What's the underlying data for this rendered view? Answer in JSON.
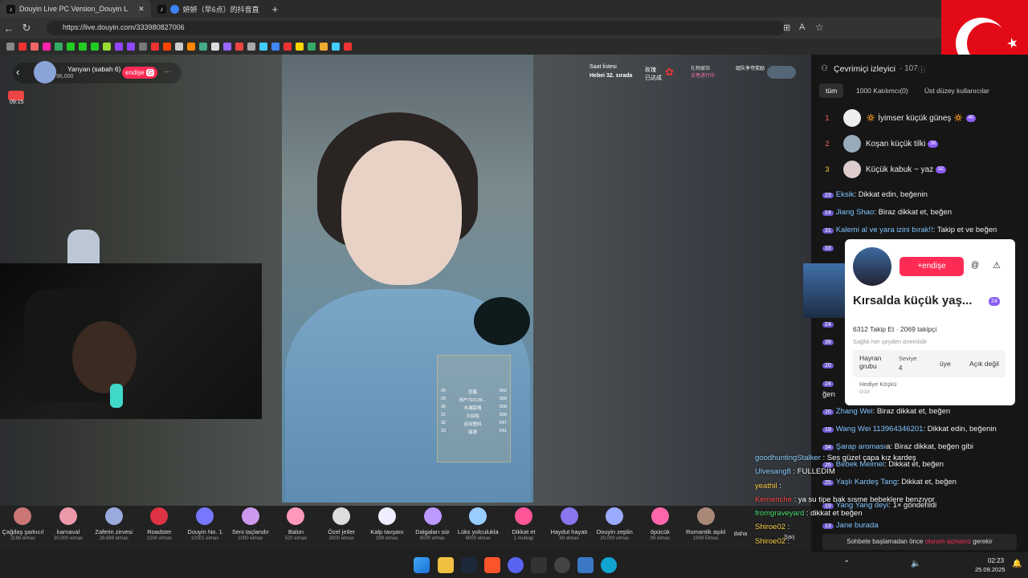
{
  "browser": {
    "tabs": [
      {
        "title": "Douyin Live PC Version_Douyin L",
        "close": "✕"
      },
      {
        "title": "妍妍（早6点）的抖音直"
      },
      {
        "title": "+"
      }
    ],
    "url": "https://live.douyin.com/333980827006"
  },
  "stream": {
    "host_name": "Yanyan (sabah 6)",
    "host_followers": "96,000",
    "follow_label": "endişe",
    "timer": "09:15",
    "hourly_rank_title": "Saat listesi",
    "hourly_rank_value": "Hebei 32. sırada",
    "promo1_line1": "玫瑰",
    "promo1_line2": "已达成",
    "promo2_line1": "礼物展馆",
    "promo2_line2": "点亮进行中",
    "promo3": "组队争夺奖励"
  },
  "ticket": {
    "rows": [
      {
        "num": "26",
        "name": "恋箱",
        "val": "562"
      },
      {
        "num": "29",
        "name": "用户703136...",
        "val": "559"
      },
      {
        "num": "30",
        "name": "木城踪情",
        "val": "558"
      },
      {
        "num": "31",
        "name": "大伯船",
        "val": "556"
      },
      {
        "num": "32",
        "name": "运动塑料",
        "val": "547"
      },
      {
        "num": "33",
        "name": "接骑",
        "val": "541"
      }
    ]
  },
  "gifts": [
    {
      "name": "Çağdaş şarkıcıl",
      "price": "3188 elmas"
    },
    {
      "name": "karnaval",
      "price": "30.000 elmas"
    },
    {
      "name": "Zaferin zirvesi",
      "price": "28.888 elmas"
    },
    {
      "name": "Roadster",
      "price": "1200 elmas"
    },
    {
      "name": "Douyin No. 1",
      "price": "10001 elmas"
    },
    {
      "name": "Seni taçlandır",
      "price": "1000 elmas"
    },
    {
      "name": "Balon",
      "price": "520 elmas"
    },
    {
      "name": "Özel jetler",
      "price": "3000 elmas"
    },
    {
      "name": "Kalp tavşanı",
      "price": "299 elmas"
    },
    {
      "name": "Dalgaları sür",
      "price": "8000 elmas"
    },
    {
      "name": "Lüks yolculukla",
      "price": "6000 elmas"
    },
    {
      "name": "Dikkat et",
      "price": "1 mutkap"
    },
    {
      "name": "Haydut hayatı",
      "price": "99 elmas"
    },
    {
      "name": "Douyin zeplin",
      "price": "20.000 elmas"
    },
    {
      "name": "öpücük",
      "price": "99 elmas"
    },
    {
      "name": "Romantik aşıkl",
      "price": "1999 Elmas"
    }
  ],
  "gift_more": "daha",
  "gift_charge": "Şarj",
  "panel": {
    "title": "Çevrimiçi izleyici",
    "count": "· 107",
    "tabs": [
      "tüm",
      "1000 Katılımcı(0)",
      "Üst düzey kullanıcılar"
    ],
    "ranking": [
      {
        "rank": "1",
        "name": "🔅 İyimser küçük güneş 🔅",
        "lv": "40"
      },
      {
        "rank": "2",
        "name": "Koşan küçük tilki",
        "lv": "30"
      },
      {
        "rank": "3",
        "name": "Küçük kabuk ~ yaz",
        "lv": "52"
      }
    ],
    "chat": [
      {
        "lv": "23",
        "user": "Eksik",
        "text": ": Dikkat edin, beğenin"
      },
      {
        "lv": "24",
        "user": "Jiang Shao",
        "text": ": Biraz dikkat et, beğen"
      },
      {
        "lv": "31",
        "user": "Kalemi al ve yara izini bırak!!",
        "text": ": Takip et ve beğen"
      },
      {
        "lv": "33",
        "user": "",
        "text": ""
      },
      {
        "lv": "24",
        "user": "",
        "text": ""
      },
      {
        "lv": "39",
        "user": "",
        "text": ""
      },
      {
        "lv": "20",
        "user": "",
        "text": ""
      },
      {
        "lv": "24",
        "user": "",
        "text": "ğen"
      },
      {
        "lv": "20",
        "user": "Zhang Wei",
        "text": ": Biraz dikkat et, beğen"
      },
      {
        "lv": "19",
        "user": "Wang Wei 113964346201",
        "text": ": Dikkat edin, beğenin"
      },
      {
        "lv": "34",
        "user": "Şarap aroması",
        "text": "a: Biraz dikkat, beğen gibi"
      },
      {
        "lv": "26",
        "user": "Bebek Meimei",
        "text": ": Dikkat et, beğen"
      },
      {
        "lv": "25",
        "user": "Yaşlı Kardeş Tang",
        "text": ": Dikkat et, beğen"
      },
      {
        "lv": "19",
        "user": "Yang Yang deyi",
        "text": ": 1× gönderildi"
      },
      {
        "lv": "13",
        "user": "Jane burada",
        "text": ""
      }
    ],
    "footer_text": "Sohbete başlamadan önce",
    "footer_link": "oturum açmanız",
    "footer_end": "gerekir"
  },
  "popup": {
    "follow_btn": "+endişe",
    "at_btn": "@",
    "report_icon": "⚠",
    "name": "Kırsalda küçük yaş...",
    "lv": "24",
    "stats": "6312 Takip Et · 2069 takipçi",
    "bio": "Sağlık her şeyden önemlidir",
    "fan_label": "Hayran grubu",
    "level_label": "Seviye",
    "level_value": "4",
    "member": "üye",
    "status": "Açık değil",
    "gift_label": "Hediye Köşkü",
    "gift_value": "0/19"
  },
  "overlay_chat": [
    {
      "user": "goodhuntingStalker",
      "text": " : Ses güzel çapa kız kardeş"
    },
    {
      "user": "Ulvesang8",
      "text": " : FULLEDIM"
    },
    {
      "user": "yeathil",
      "text": " : "
    },
    {
      "user": "Kernenche",
      "text": " : ya su tipe bak sısme bebeklere benzıyor"
    },
    {
      "user": "fromgraveyard",
      "text": " : dikkat et beğen"
    },
    {
      "user": "Shiroe02",
      "text": " : "
    },
    {
      "user": "Shiroe02",
      "text": " : "
    }
  ],
  "taskbar": {
    "time": "02:23",
    "date": "25.09.2025"
  }
}
